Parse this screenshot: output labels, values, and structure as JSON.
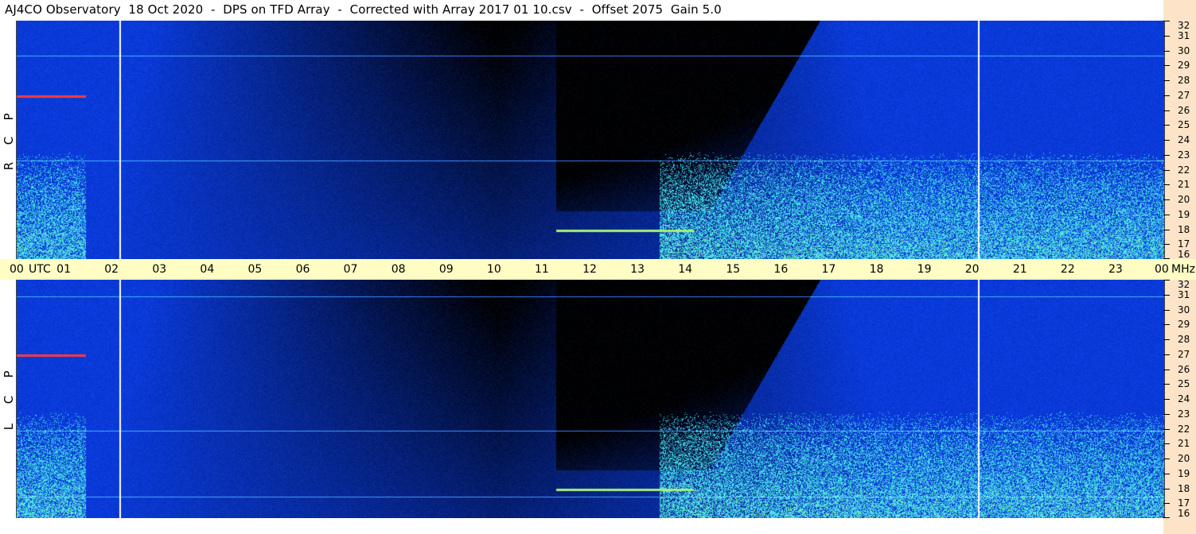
{
  "header": {
    "title": "AJ4CO Observatory  18 Oct 2020  -  DPS on TFD Array  -  Corrected with Array 2017 01 10.csv  -  Offset 2075  Gain 5.0"
  },
  "time_axis": {
    "start_label": "00",
    "utc_label": "UTC",
    "hours": [
      "01",
      "02",
      "03",
      "04",
      "05",
      "06",
      "07",
      "08",
      "09",
      "10",
      "11",
      "12",
      "13",
      "14",
      "15",
      "16",
      "17",
      "18",
      "19",
      "20",
      "21",
      "22",
      "23"
    ],
    "end_label": "00",
    "freq_unit": "MHz"
  },
  "freq_axis": {
    "labels": [
      "32",
      "31",
      "30",
      "29",
      "28",
      "27",
      "26",
      "25",
      "24",
      "23",
      "22",
      "21",
      "20",
      "19",
      "18",
      "17",
      "16"
    ]
  },
  "panels": [
    {
      "id": "rcp",
      "letters": [
        "R",
        "C",
        "P"
      ]
    },
    {
      "id": "lcp",
      "letters": [
        "L",
        "C",
        "P"
      ]
    }
  ],
  "colors": {
    "background": "#0a3ad8",
    "quiet_dark": "#000000",
    "noise_cyan": "#27e6f2",
    "noise_green": "#a5f07a",
    "hot_red": "#ff3a3a",
    "marker_white": "#ffffff",
    "time_band": "#fffdc4",
    "scale_band": "#fde4c8"
  }
}
